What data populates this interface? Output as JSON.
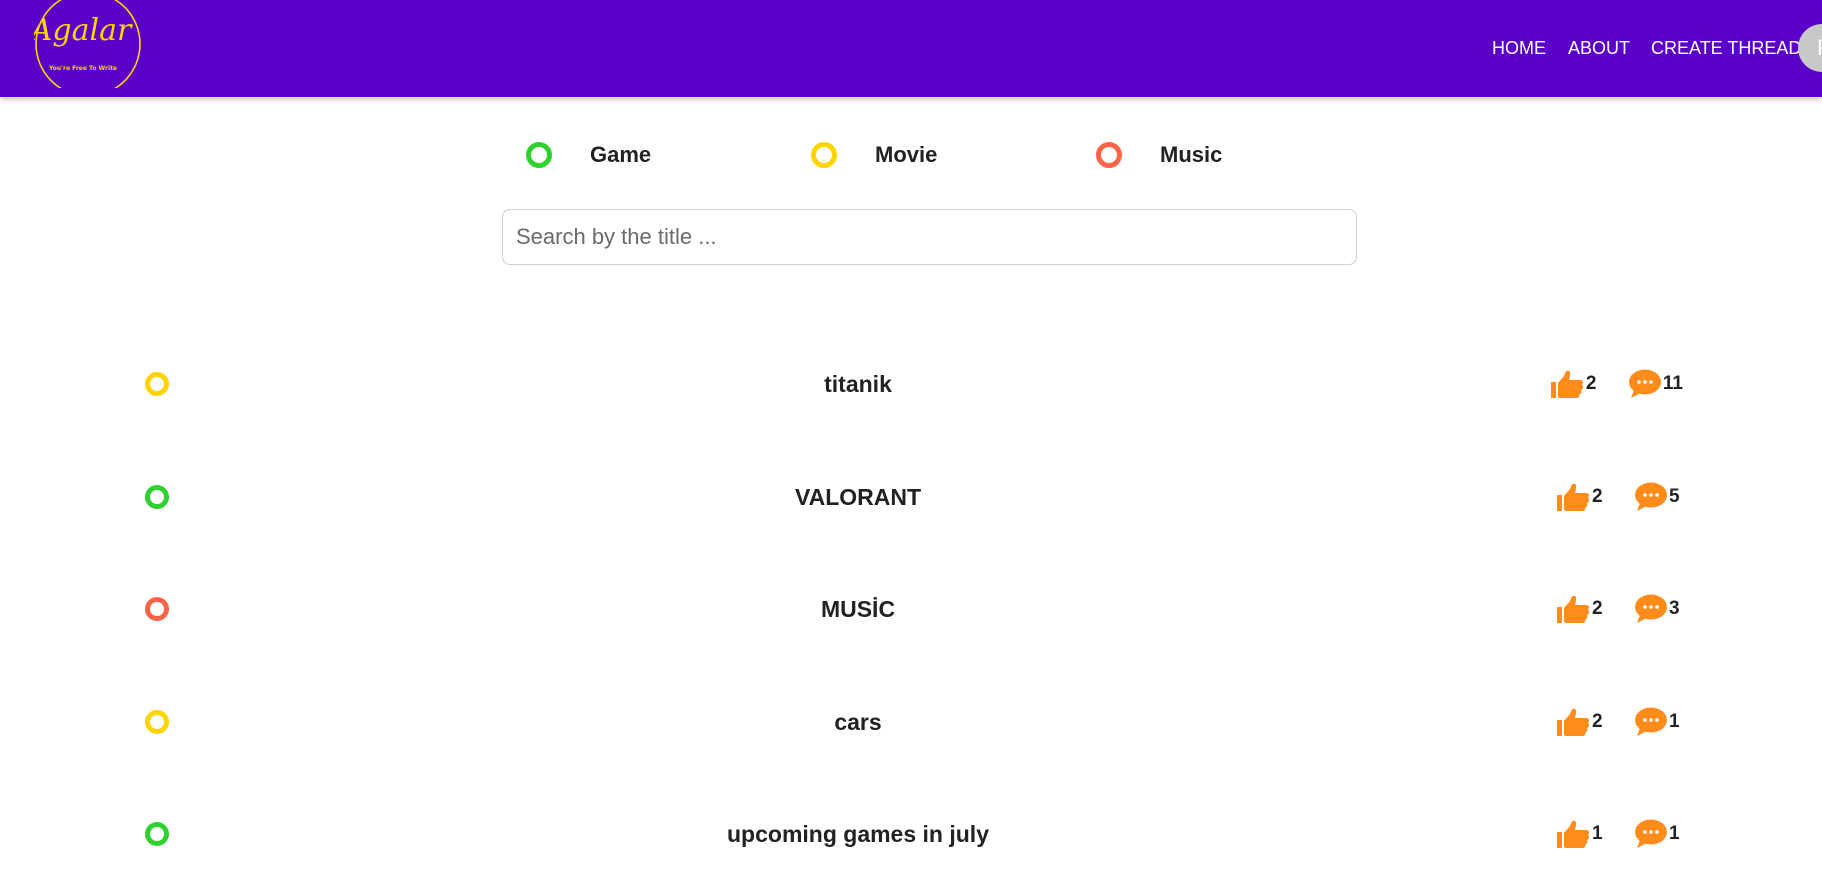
{
  "app": {
    "logo_text": "Agalar",
    "logo_tagline": "You're Free To Write"
  },
  "nav": {
    "home": "HOME",
    "about": "ABOUT",
    "create_thread": "CREATE THREAD",
    "avatar_initial": "F"
  },
  "filters": [
    {
      "label": "Game",
      "color": "#2ed12e"
    },
    {
      "label": "Movie",
      "color": "#ffd400"
    },
    {
      "label": "Music",
      "color": "#ff6347"
    }
  ],
  "search": {
    "placeholder": "Search by the title ...",
    "value": ""
  },
  "colors": {
    "navbar": "#5b00c9",
    "accent_icon": "#ff8c1a",
    "logo": "#ffd400"
  },
  "threads": [
    {
      "title": "titanik",
      "category": "Movie",
      "color": "#ffd400",
      "likes": "2",
      "comments": "11"
    },
    {
      "title": "VALORANT",
      "category": "Game",
      "color": "#2ed12e",
      "likes": "2",
      "comments": "5"
    },
    {
      "title": "MUSİC",
      "category": "Music",
      "color": "#ff6347",
      "likes": "2",
      "comments": "3"
    },
    {
      "title": "cars",
      "category": "Movie",
      "color": "#ffd400",
      "likes": "2",
      "comments": "1"
    },
    {
      "title": "upcoming games in july",
      "category": "Game",
      "color": "#2ed12e",
      "likes": "1",
      "comments": "1"
    }
  ],
  "icons": {
    "like": "thumbs-up-icon",
    "comment": "comment-bubble-icon"
  }
}
